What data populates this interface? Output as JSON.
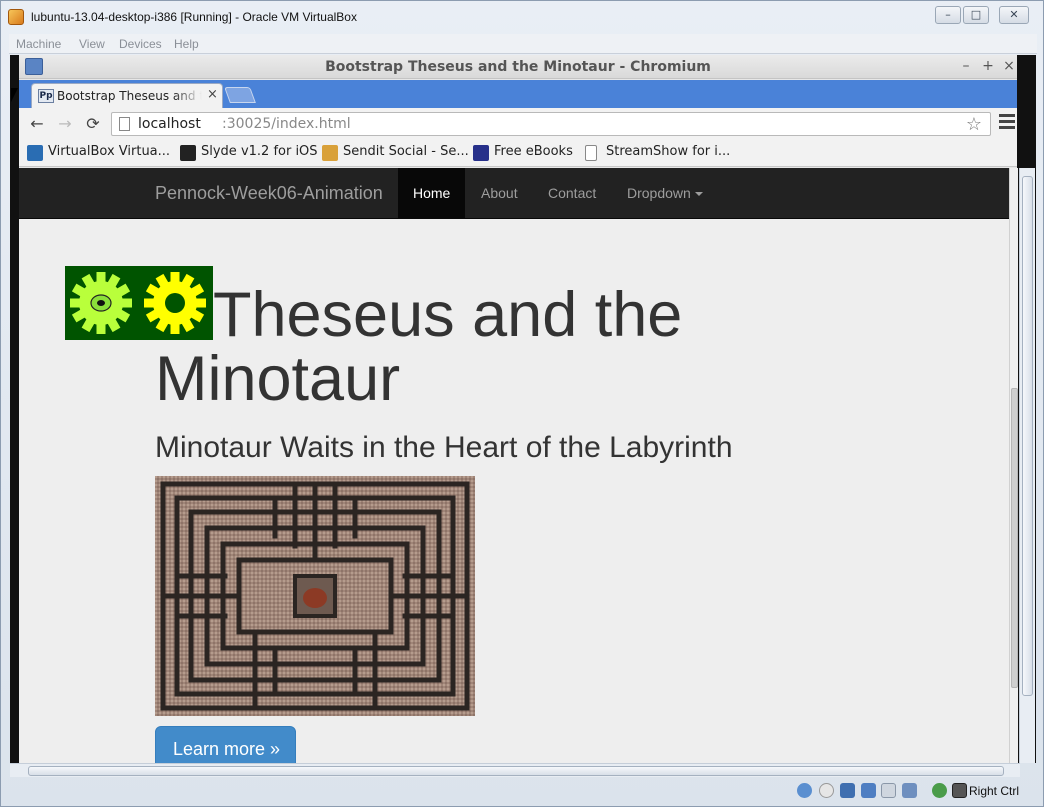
{
  "vbox": {
    "title": "lubuntu-13.04-desktop-i386 [Running] - Oracle VM VirtualBox",
    "menu": [
      "Machine",
      "View",
      "Devices",
      "Help"
    ],
    "controls": {
      "minimize": "–",
      "maximize": "□",
      "close": "✕"
    },
    "host_key_label": "Right Ctrl"
  },
  "chromium": {
    "window_title": "Bootstrap Theseus and the Minotaur - Chromium",
    "controls": {
      "minimize": "–",
      "maximize": "+",
      "close": "×"
    },
    "tab": {
      "favicon_text": "Pp",
      "title": "Bootstrap Theseus and the Minotaur",
      "close": "×"
    },
    "nav": {
      "back": "←",
      "forward": "→",
      "reload": "⟳"
    },
    "url": {
      "host": "localhost",
      "rest": ":30025/index.html"
    },
    "star": "☆",
    "bookmarks": [
      {
        "label": "VirtualBox Virtua...",
        "icon": "virtualbox-icon",
        "color": "#2a6db3"
      },
      {
        "label": "Slyde v1.2 for iOS",
        "icon": "slyde-icon",
        "color": "#222222"
      },
      {
        "label": "Sendit Social - Se...",
        "icon": "sendit-icon",
        "color": "#d9a13a"
      },
      {
        "label": "Free eBooks",
        "icon": "book-icon",
        "color": "#27308a"
      },
      {
        "label": "StreamShow for i...",
        "icon": "page-icon",
        "color": "#ffffff"
      }
    ]
  },
  "page": {
    "brand": "Pennock-Week06-Animation",
    "nav": [
      {
        "label": "Home",
        "active": true
      },
      {
        "label": "About",
        "active": false
      },
      {
        "label": "Contact",
        "active": false
      },
      {
        "label": "Dropdown",
        "active": false
      }
    ],
    "heading_line1": "Theseus and the",
    "heading_line2": "Minotaur",
    "subheading": "Minotaur Waits in the Heart of the Labyrinth",
    "button": "Learn more »"
  },
  "colors": {
    "navbar": "#222222",
    "primary": "#428bca",
    "tabstrip": "#4a82d8",
    "gear_bg": "#005400",
    "gear_left": "#b9ff3b",
    "gear_right": "#ffff00"
  }
}
